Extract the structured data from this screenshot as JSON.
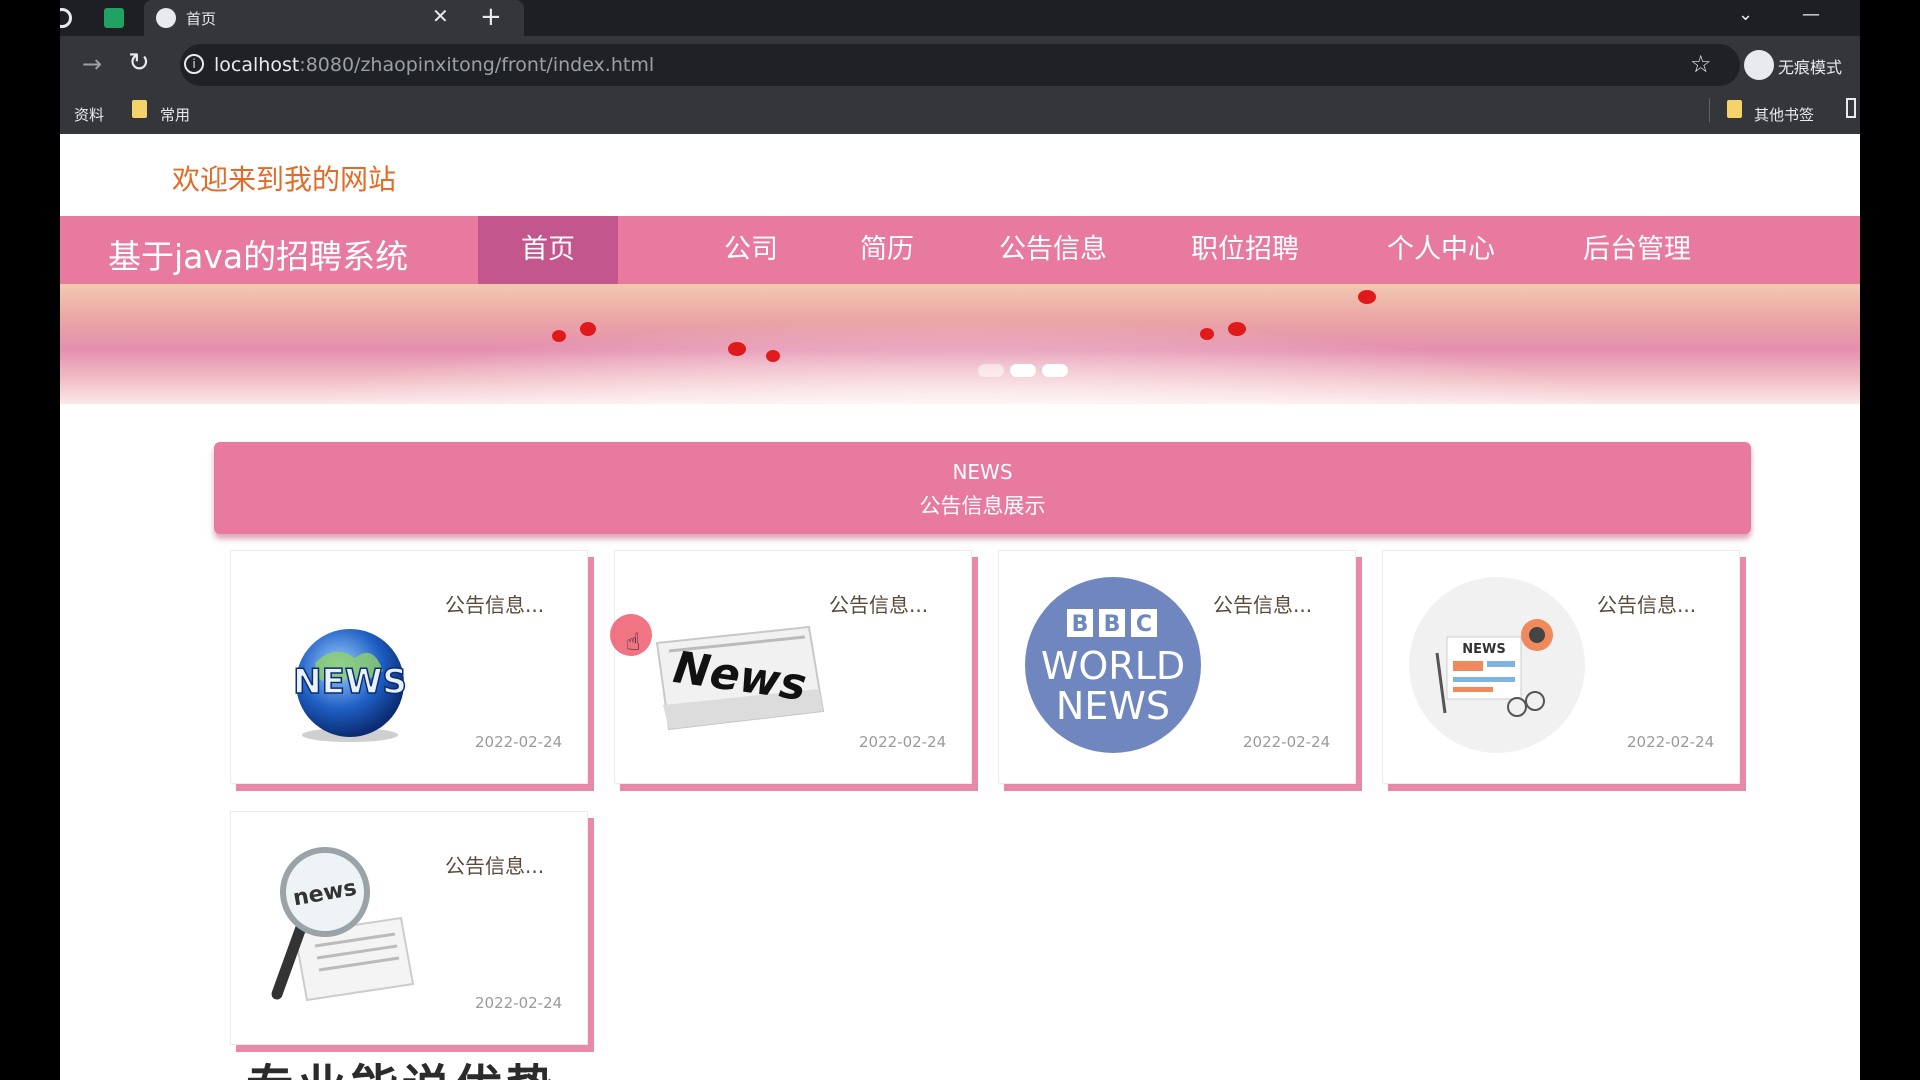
{
  "browser": {
    "tab_title": "首页",
    "url_host": "localhost",
    "url_path": ":8080/zhaopinxitong/front/index.html",
    "incognito_label": "无痕模式",
    "bookmarks": [
      "资料",
      "常用"
    ],
    "other_bookmarks": "其他书签"
  },
  "site": {
    "welcome": "欢迎来到我的网站",
    "title": "基于java的招聘系统",
    "nav": [
      "首页",
      "公司",
      "简历",
      "公告信息",
      "职位招聘",
      "个人中心",
      "后台管理"
    ]
  },
  "news": {
    "header_en": "NEWS",
    "header_cn": "公告信息展示",
    "cards": [
      {
        "title": "公告信息...",
        "date": "2022-02-24",
        "image": "globe-news-icon"
      },
      {
        "title": "公告信息...",
        "date": "2022-02-24",
        "image": "newspaper-news-icon",
        "image_text": "News"
      },
      {
        "title": "公告信息...",
        "date": "2022-02-24",
        "image": "bbc-world-news-logo",
        "image_text": "BBC WORLD NEWS"
      },
      {
        "title": "公告信息...",
        "date": "2022-02-24",
        "image": "news-illustration-icon",
        "image_text": "NEWS"
      },
      {
        "title": "公告信息...",
        "date": "2022-02-24",
        "image": "magnifier-news-icon",
        "image_text": "news"
      }
    ]
  },
  "bottom_heading": "专业能说优势"
}
